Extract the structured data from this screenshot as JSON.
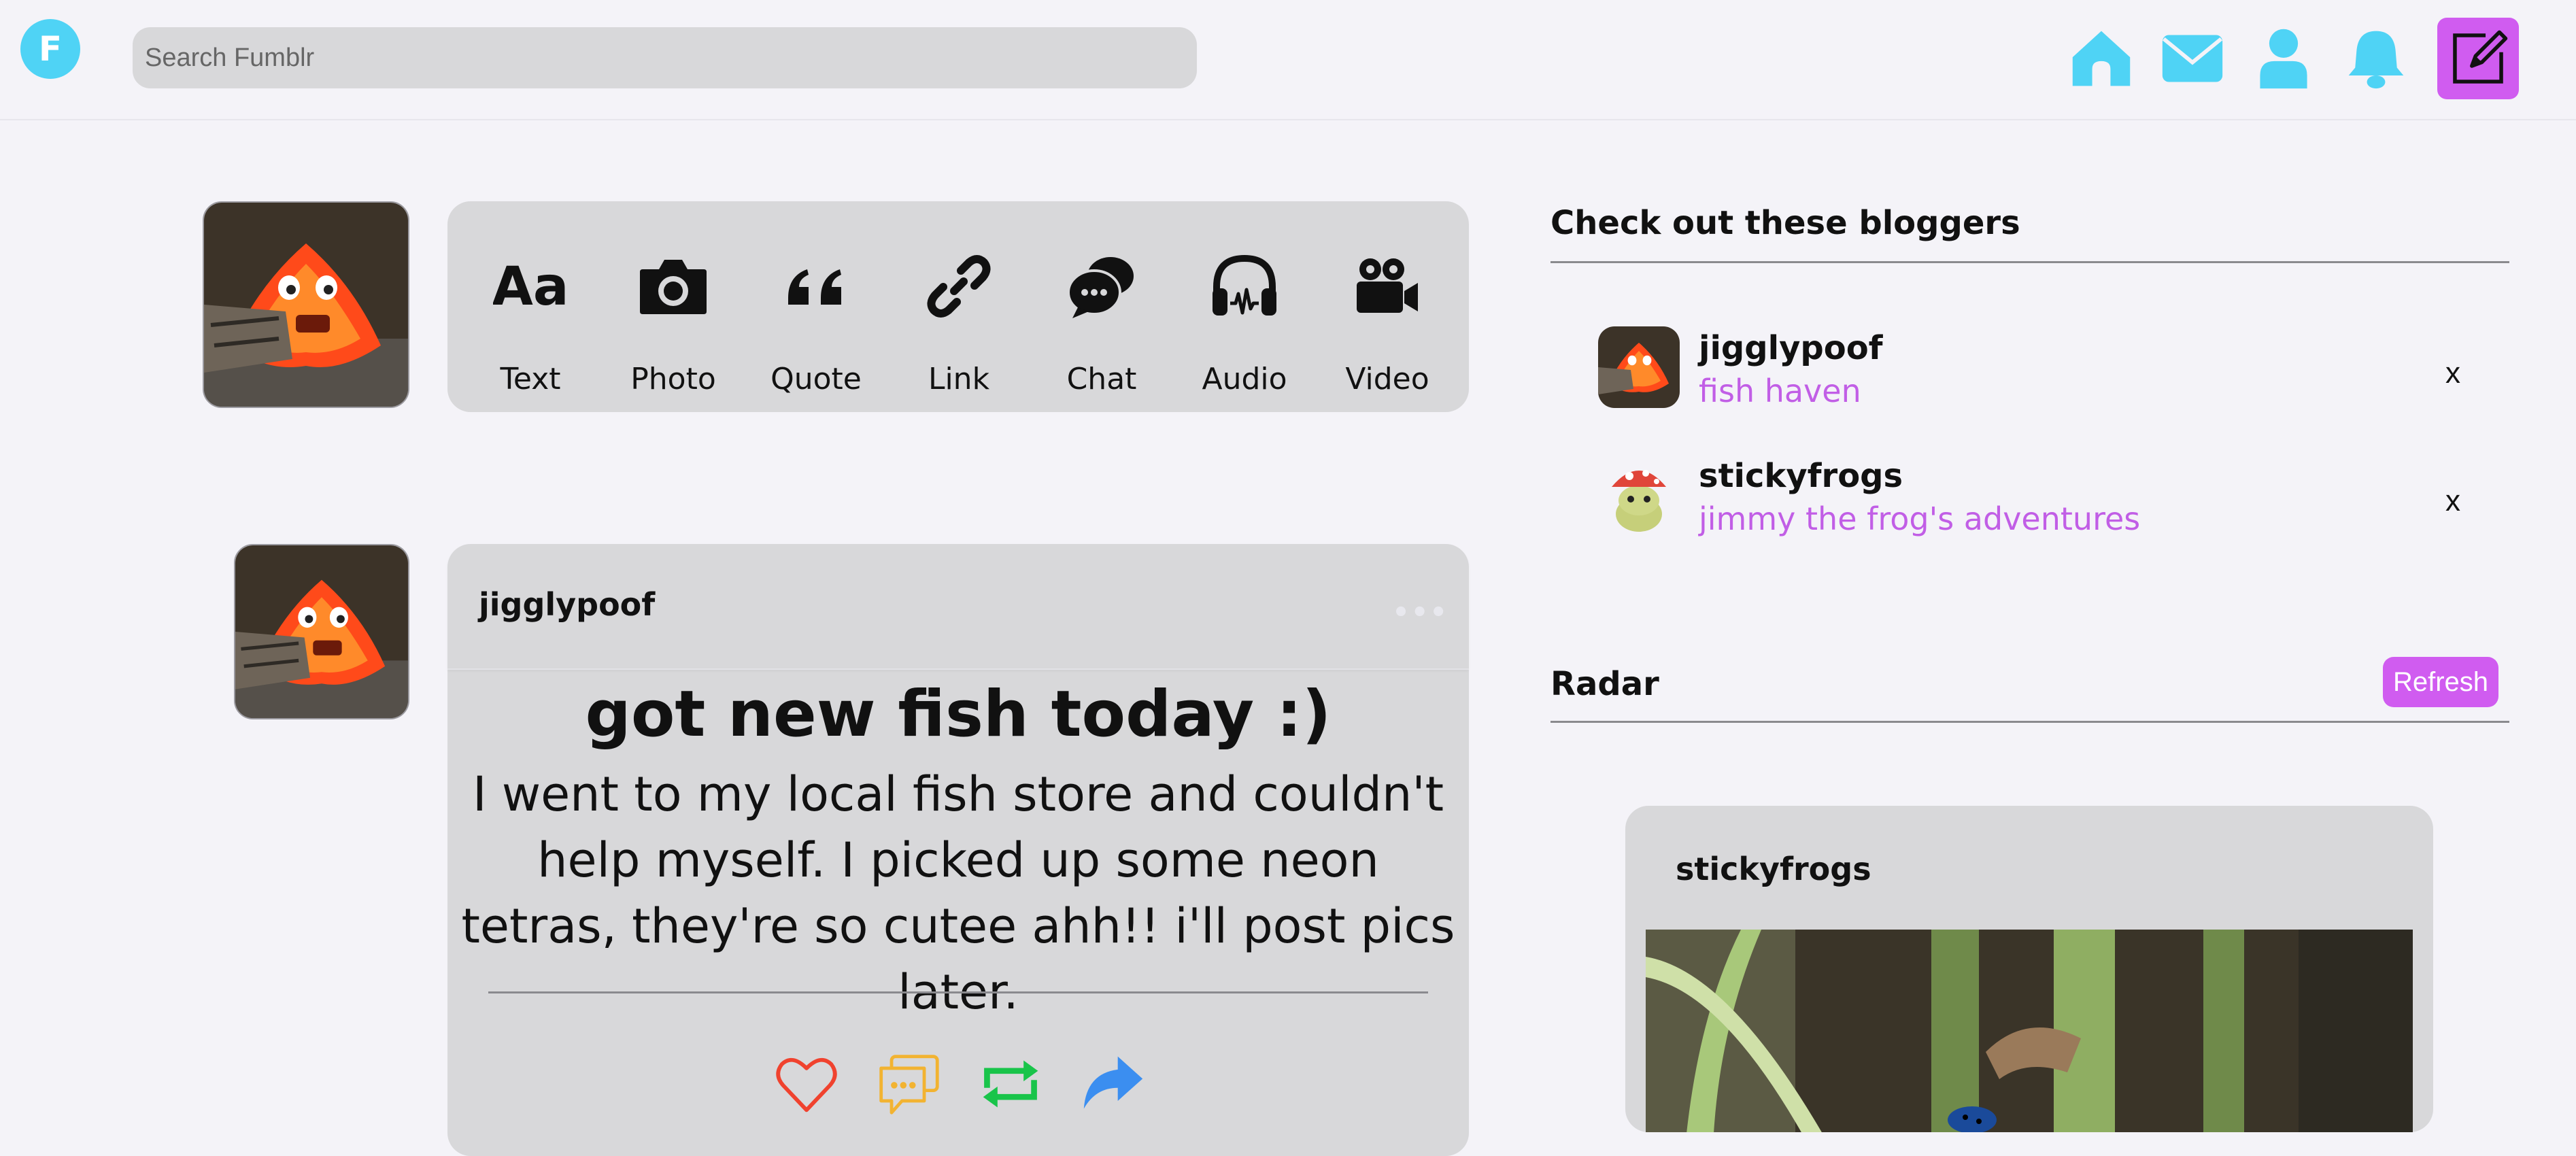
{
  "app": {
    "logo_letter": "F",
    "search_placeholder": "Search Fumblr",
    "accent_color": "#4fd3f5",
    "brand_purple": "#d05cf0"
  },
  "nav": {
    "icons": [
      "home-icon",
      "mail-icon",
      "user-icon",
      "bell-icon",
      "compose-icon"
    ]
  },
  "post_types": [
    {
      "label": "Text",
      "icon": "text-icon"
    },
    {
      "label": "Photo",
      "icon": "camera-icon"
    },
    {
      "label": "Quote",
      "icon": "quote-icon"
    },
    {
      "label": "Link",
      "icon": "link-icon"
    },
    {
      "label": "Chat",
      "icon": "chat-icon"
    },
    {
      "label": "Audio",
      "icon": "headphones-icon"
    },
    {
      "label": "Video",
      "icon": "video-camera-icon"
    }
  ],
  "post": {
    "author": "jigglypoof",
    "more": "•••",
    "title": "got new fish today :)",
    "body": "I went to my local fish store and couldn't help myself. I picked up some neon tetras, they're so cutee ahh!! i'll post pics later.",
    "actions": [
      "heart-icon",
      "comment-icon",
      "reblog-icon",
      "share-icon"
    ]
  },
  "bloggers": {
    "title": "Check out these bloggers",
    "items": [
      {
        "name": "jigglypoof",
        "blog": "fish haven",
        "dismiss": "x"
      },
      {
        "name": "stickyfrogs",
        "blog": "jimmy the frog's adventures",
        "dismiss": "x"
      }
    ]
  },
  "radar": {
    "title": "Radar",
    "refresh_label": "Refresh",
    "author": "stickyfrogs"
  }
}
